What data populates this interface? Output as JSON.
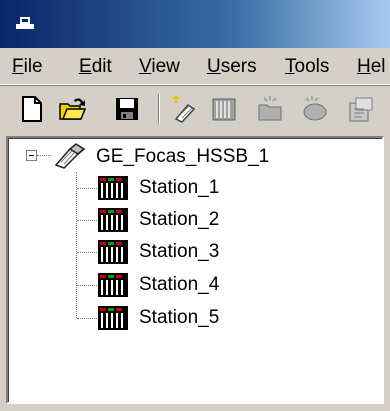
{
  "menu": {
    "items": [
      {
        "mnemonic": "F",
        "rest": "ile"
      },
      {
        "mnemonic": "E",
        "rest": "dit"
      },
      {
        "mnemonic": "V",
        "rest": "iew"
      },
      {
        "mnemonic": "U",
        "rest": "sers"
      },
      {
        "mnemonic": "T",
        "rest": "ools"
      },
      {
        "mnemonic": "",
        "rest": "Hel"
      }
    ]
  },
  "toolbar": {
    "buttons": [
      "new-file-icon",
      "open-folder-icon",
      "save-icon",
      "new-channel-icon",
      "new-device-icon",
      "new-tag-group-icon",
      "new-tag-icon",
      "properties-icon"
    ]
  },
  "tree": {
    "root": {
      "label": "GE_Focas_HSSB_1",
      "icon": "channel-icon"
    },
    "children": [
      {
        "label": "Station_1",
        "icon": "device-icon"
      },
      {
        "label": "Station_2",
        "icon": "device-icon"
      },
      {
        "label": "Station_3",
        "icon": "device-icon"
      },
      {
        "label": "Station_4",
        "icon": "device-icon"
      },
      {
        "label": "Station_5",
        "icon": "device-icon"
      }
    ]
  },
  "colors": {
    "titlebar_start": "#0a246a",
    "face": "#d4d0c8"
  }
}
